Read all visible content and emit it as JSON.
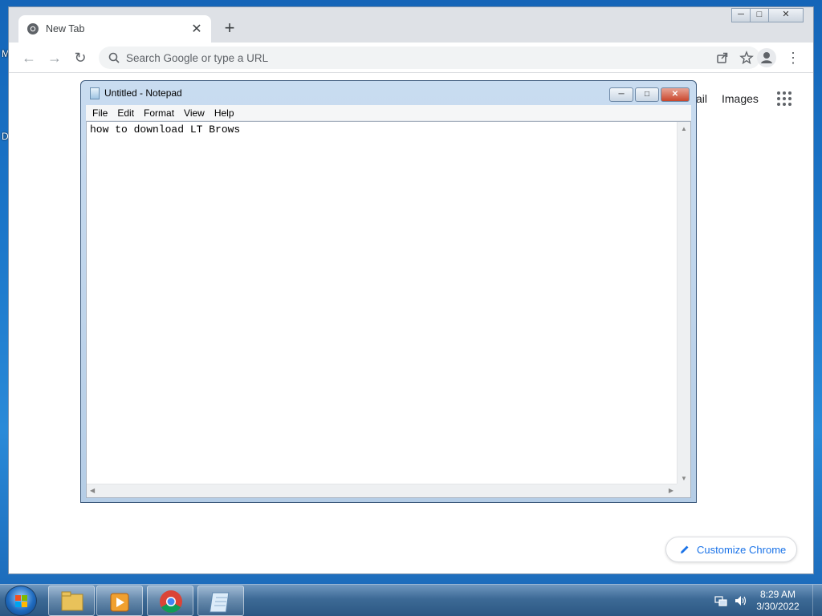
{
  "desktop": {
    "edge_letters": [
      "M",
      "D"
    ]
  },
  "browser": {
    "tab_title": "New Tab",
    "tab_close": "✕",
    "new_tab": "+",
    "back": "←",
    "forward": "→",
    "reload": "↻",
    "omnibox_placeholder": "Search Google or type a URL",
    "menu": "⋮",
    "ntp": {
      "gmail_partial": "ail",
      "images": "Images",
      "customize_label": "Customize Chrome"
    },
    "window_controls": {
      "minimize": "─",
      "maximize": "□",
      "close": "✕"
    }
  },
  "notepad": {
    "title": "Untitled - Notepad",
    "menu": [
      "File",
      "Edit",
      "Format",
      "View",
      "Help"
    ],
    "content": "how to download LT Brows",
    "controls": {
      "minimize": "─",
      "maximize": "□",
      "close": "✕"
    },
    "scroll_arrows": {
      "up": "▲",
      "down": "▼",
      "left": "◀",
      "right": "▶"
    }
  },
  "taskbar": {
    "apps": [
      "file-explorer",
      "media-player",
      "chrome",
      "notepad"
    ],
    "clock_time": "8:29 AM",
    "clock_date": "3/30/2022"
  }
}
